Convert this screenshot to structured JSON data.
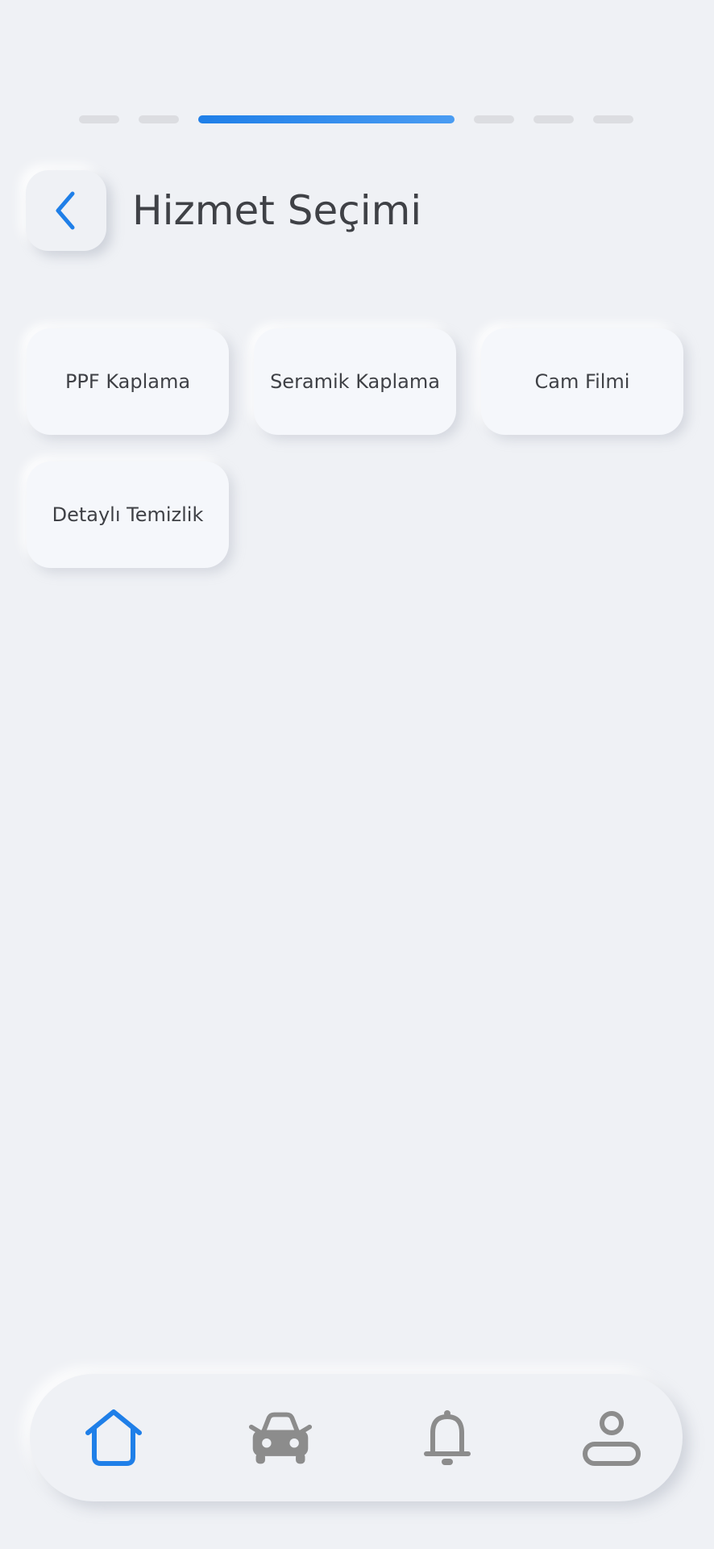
{
  "progress": {
    "total_steps": 6,
    "current_step": 3
  },
  "header": {
    "title": "Hizmet Seçimi",
    "back_icon": "chevron-left-icon"
  },
  "services": [
    {
      "label": "PPF Kaplama"
    },
    {
      "label": "Seramik Kaplama"
    },
    {
      "label": "Cam Filmi"
    },
    {
      "label": "Detaylı Temizlik"
    }
  ],
  "bottom_nav": {
    "items": [
      {
        "icon": "home-icon",
        "active": true
      },
      {
        "icon": "car-icon",
        "active": false
      },
      {
        "icon": "bell-icon",
        "active": false
      },
      {
        "icon": "user-icon",
        "active": false
      }
    ]
  },
  "colors": {
    "accent": "#1f7fe8",
    "background": "#eff1f5",
    "inactive_icon": "#8c8c8c",
    "text": "#3f4146"
  }
}
